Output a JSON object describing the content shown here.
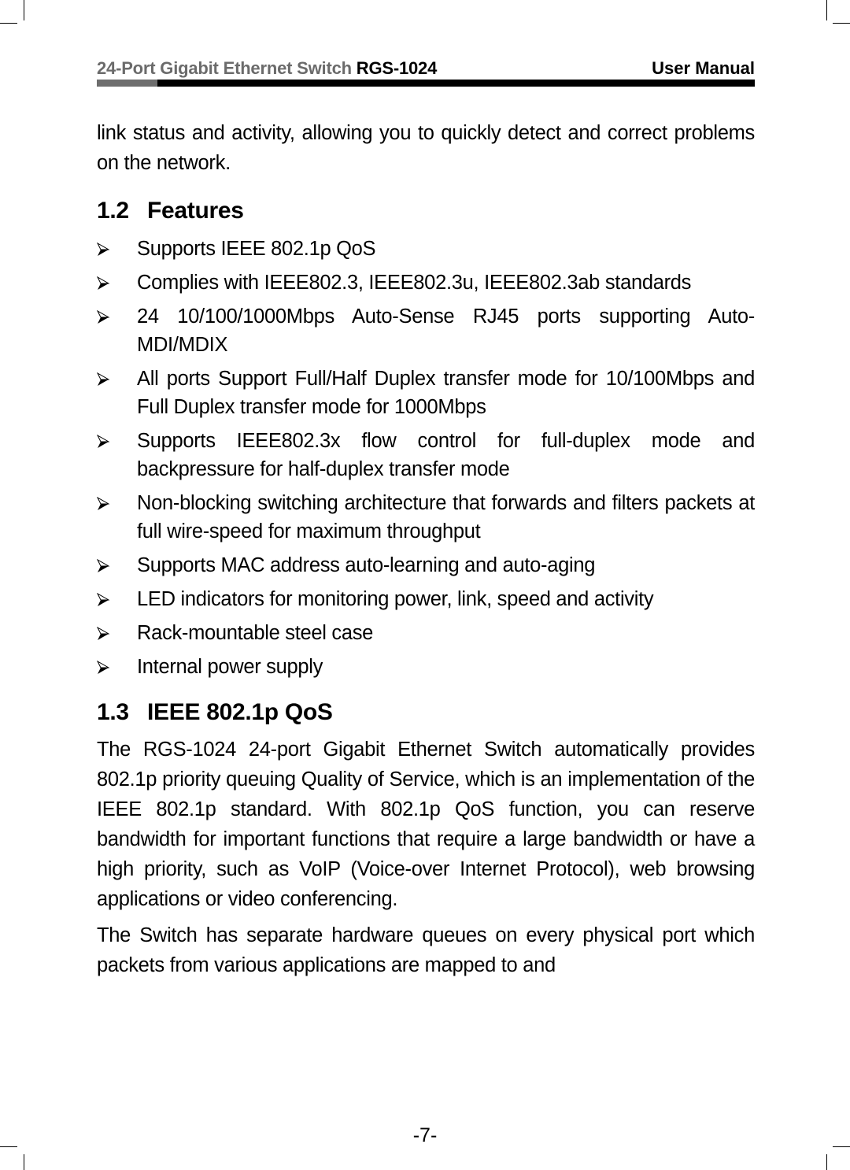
{
  "header": {
    "product": "24-Port Gigabit Ethernet Switch",
    "model": "RGS-1024",
    "doc_type": "User Manual"
  },
  "intro_text": "link status and activity, allowing you to quickly detect and correct problems on the network.",
  "sections": {
    "features": {
      "number": "1.2",
      "title": "Features",
      "bullet_icon": "arrow-bullet-icon",
      "items": [
        "Supports IEEE 802.1p QoS",
        "Complies with IEEE802.3, IEEE802.3u, IEEE802.3ab standards",
        "24 10/100/1000Mbps Auto-Sense RJ45 ports supporting Auto-MDI/MDIX",
        "All ports Support Full/Half Duplex transfer mode for 10/100Mbps and Full Duplex transfer mode for 1000Mbps",
        "Supports IEEE802.3x flow control for full-duplex mode and backpressure for half-duplex transfer mode",
        "Non-blocking switching architecture that forwards and filters packets at full wire-speed for maximum throughput",
        "Supports MAC address auto-learning and auto-aging",
        "LED indicators for monitoring power, link, speed and activity",
        "Rack-mountable steel case",
        "Internal power supply"
      ]
    },
    "qos": {
      "number": "1.3",
      "title": "IEEE 802.1p QoS",
      "paragraphs": [
        "The RGS-1024 24-port Gigabit Ethernet Switch automatically provides 802.1p priority queuing Quality of Service, which is an implementation of the IEEE 802.1p standard. With 802.1p QoS function, you can reserve bandwidth for important functions that require a large bandwidth or have a high priority, such as VoIP (Voice-over Internet Protocol), web browsing applications or video conferencing.",
        "The Switch has separate hardware queues on every physical port which packets from various applications are mapped to and"
      ]
    }
  },
  "footer": {
    "page_number": "-7-"
  }
}
